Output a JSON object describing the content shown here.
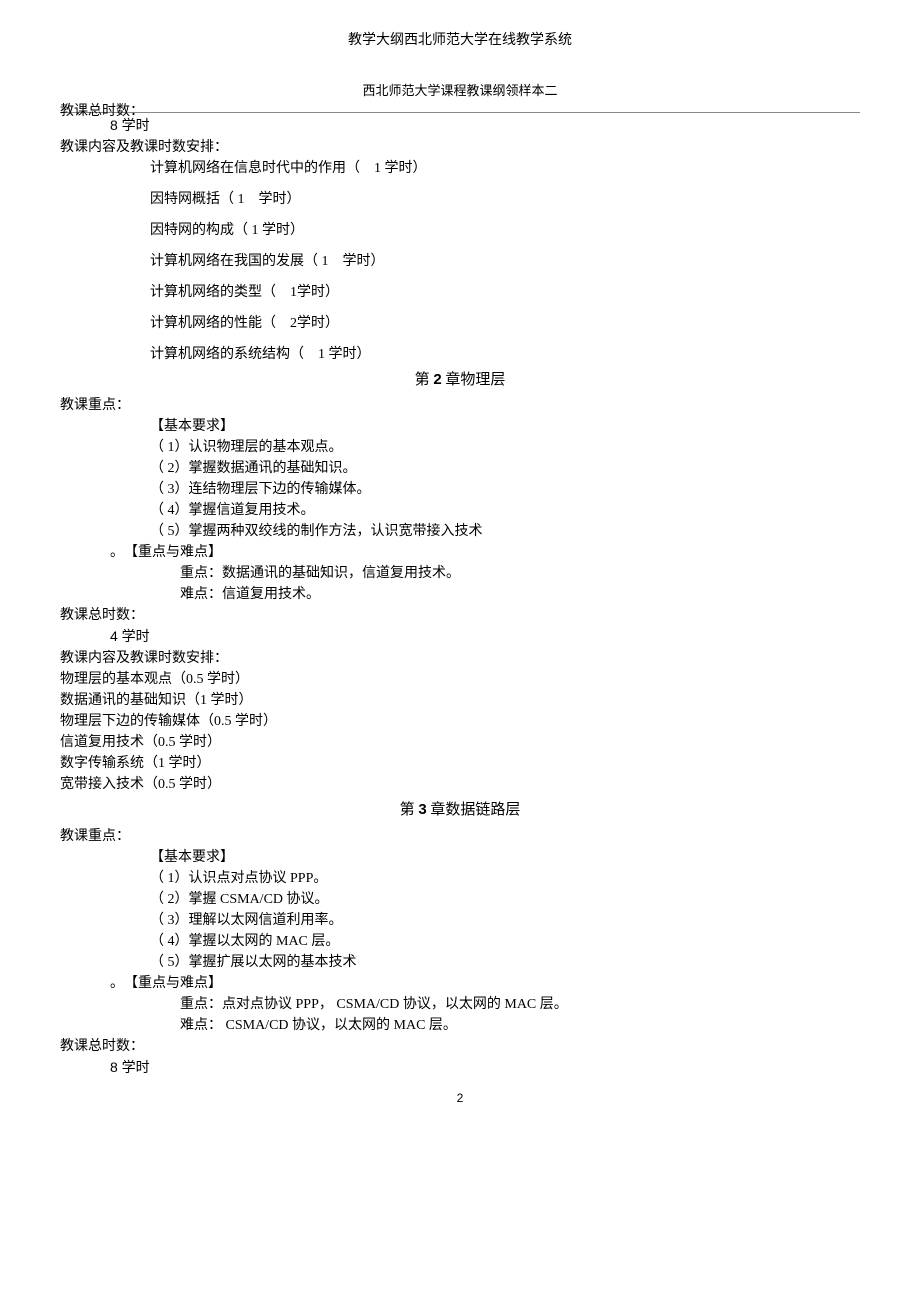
{
  "header": {
    "main_title": "教学大纲西北师范大学在线教学系统",
    "sub_title": "西北师范大学课程教课纲领样本二"
  },
  "section1": {
    "total_hours_label": "教课总时数：",
    "total_hours_value": "8 学时",
    "content_label": "教课内容及教课时数安排：",
    "items": [
      "计算机网络在信息时代中的作用（　1 学时）",
      "因特网概括（ 1　学时）",
      "因特网的构成（ 1 学时）",
      "计算机网络在我国的发展（ 1　学时）",
      "计算机网络的类型（　1学时）",
      "计算机网络的性能（　2学时）",
      "计算机网络的系统结构（　1 学时）"
    ]
  },
  "chapter2": {
    "title_prefix": "第 ",
    "title_num": "2",
    "title_suffix": " 章物理层",
    "focus_label": "教课重点：",
    "basic_req_label": "【基本要求】",
    "req_items": [
      "（ 1）认识物理层的基本观点。",
      "（ 2）掌握数据通讯的基础知识。",
      "（ 3）连结物理层下边的传输媒体。",
      "（ 4）掌握信道复用技术。",
      "（ 5）掌握两种双绞线的制作方法，认识宽带接入技术"
    ],
    "kd_prefix": "。",
    "kd_label": "【重点与难点】",
    "kd_focus": "重点：数据通讯的基础知识，信道复用技术。",
    "kd_diff": "难点：信道复用技术。",
    "total_hours_label": "教课总时数：",
    "total_hours_value": "4 学时",
    "content_label": "教课内容及教课时数安排：",
    "content_items": [
      "物理层的基本观点（0.5 学时）",
      "数据通讯的基础知识（1 学时）",
      "物理层下边的传输媒体（0.5 学时）",
      "信道复用技术（0.5 学时）",
      "数字传输系统（1 学时）",
      "宽带接入技术（0.5 学时）"
    ]
  },
  "chapter3": {
    "title_prefix": "第 ",
    "title_num": "3",
    "title_suffix": " 章数据链路层",
    "focus_label": "教课重点：",
    "basic_req_label": "【基本要求】",
    "req_items": [
      "（ 1）认识点对点协议  PPP。",
      "（ 2）掌握  CSMA/CD  协议。",
      "（ 3）理解以太网信道利用率。",
      "（ 4）掌握以太网的  MAC  层。",
      "（ 5）掌握扩展以太网的基本技术"
    ],
    "kd_prefix": "。",
    "kd_label": "【重点与难点】",
    "kd_focus": "重点：点对点协议 PPP， CSMA/CD  协议，以太网的 MAC  层。",
    "kd_diff": "难点： CSMA/CD 协议，以太网的 MAC 层。",
    "total_hours_label": "教课总时数：",
    "total_hours_value": "8 学时"
  },
  "page_number": "2"
}
